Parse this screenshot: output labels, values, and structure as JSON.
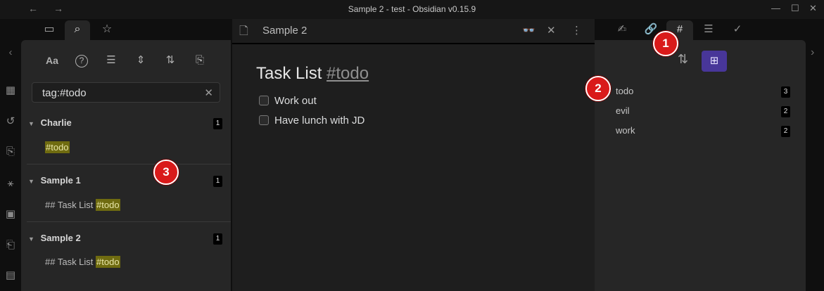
{
  "window": {
    "title": "Sample 2 - test - Obsidian v0.15.9",
    "back_glyph": "←",
    "forward_glyph": "→",
    "minimize_glyph": "—",
    "maximize_glyph": "☐",
    "close_glyph": "✕"
  },
  "ribbon": {
    "collapse_glyph": "‹",
    "icons": [
      "table-icon",
      "history-icon",
      "import-icon",
      "graph-icon",
      "calendar-icon",
      "template-icon",
      "slides-icon"
    ],
    "glyphs": [
      "▦",
      "↺",
      "⎘",
      "⚹",
      "▣",
      "⎗",
      "▤"
    ]
  },
  "left_tabs": {
    "glyphs": [
      "▭",
      "⌕",
      "☆"
    ],
    "icons": [
      "folder-icon",
      "search-icon",
      "star-icon"
    ],
    "active": 1
  },
  "search_panel": {
    "tools": {
      "match_case": "Aa",
      "explain": "?",
      "list_glyph": "☰",
      "collapse_glyph": "⇕",
      "sort_glyph": "⇅",
      "copy_glyph": "⎘"
    },
    "query": "tag:#todo",
    "clear_glyph": "✕",
    "results": [
      {
        "file": "Charlie",
        "count": "1",
        "prefix": "",
        "tag": "#todo"
      },
      {
        "file": "Sample 1",
        "count": "1",
        "prefix": "## Task List ",
        "tag": "#todo"
      },
      {
        "file": "Sample 2",
        "count": "1",
        "prefix": "## Task List ",
        "tag": "#todo"
      }
    ]
  },
  "editor": {
    "tab_title": "Sample 2",
    "doc_glyph": "🗋",
    "reading_glyph": "👓",
    "close_glyph": "✕",
    "more_glyph": "⋮",
    "heading": "Task List ",
    "heading_tag": "#todo",
    "tasks": [
      "Work out",
      "Have lunch with JD"
    ]
  },
  "right_tabs": {
    "glyphs": [
      "✍",
      "🔗",
      "#",
      "☰",
      "✓"
    ],
    "icons": [
      "backlinks-icon",
      "outgoing-links-icon",
      "tag-icon",
      "outline-icon",
      "tasks-icon"
    ],
    "active": 2
  },
  "tag_pane": {
    "sort_glyph": "⇅",
    "tree_glyph": "⊞",
    "tags": [
      {
        "name": "todo",
        "count": "3"
      },
      {
        "name": "evil",
        "count": "2"
      },
      {
        "name": "work",
        "count": "2"
      }
    ]
  },
  "edges": {
    "left": "‹",
    "right": "›"
  },
  "callouts": [
    "1",
    "2",
    "3"
  ]
}
